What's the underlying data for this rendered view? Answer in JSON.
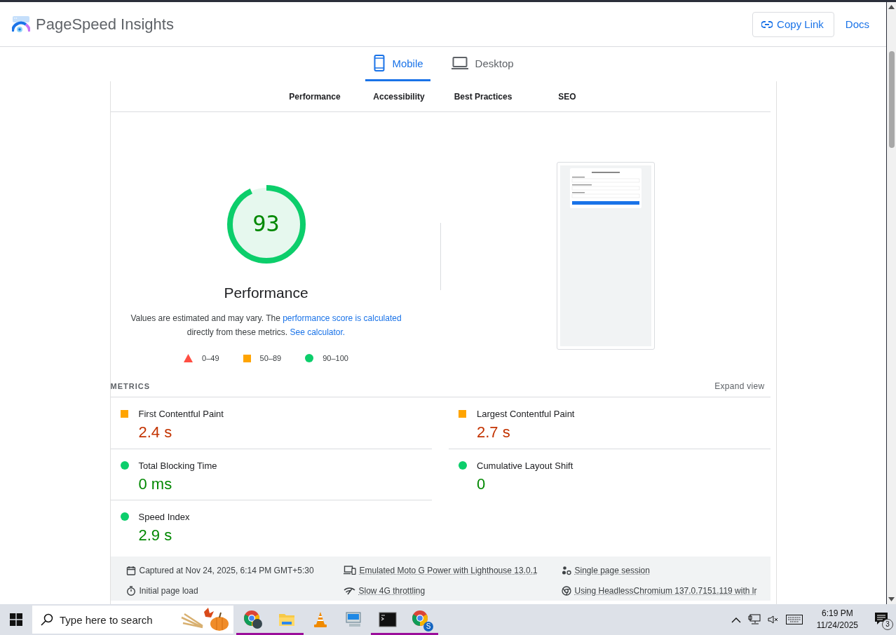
{
  "header": {
    "title": "PageSpeed Insights",
    "copy_link": "Copy Link",
    "docs": "Docs"
  },
  "device_tabs": [
    {
      "label": "Mobile",
      "kind": "mobile",
      "selected": true
    },
    {
      "label": "Desktop",
      "kind": "desktop",
      "selected": false
    }
  ],
  "category_tabs": [
    "Performance",
    "Accessibility",
    "Best Practices",
    "SEO"
  ],
  "score": {
    "value": "93",
    "level": 0.93,
    "kind": "pass",
    "label": "Performance"
  },
  "note": [
    {
      "kind": "text",
      "text": "Values are estimated and may vary. The "
    },
    {
      "kind": "link",
      "text": "performance score is calculated"
    },
    {
      "kind": "text",
      "text": " directly from these metrics. "
    },
    {
      "kind": "link",
      "text": "See calculator."
    }
  ],
  "legend": [
    {
      "kind": "fail",
      "range": "0–49"
    },
    {
      "kind": "average",
      "range": "50–89"
    },
    {
      "kind": "pass",
      "range": "90–100"
    }
  ],
  "metrics": {
    "title": "METRICS",
    "expand": "Expand view",
    "items": [
      {
        "name": "First Contentful Paint",
        "value": "2.4 s",
        "kind": "average"
      },
      {
        "name": "Largest Contentful Paint",
        "value": "2.7 s",
        "kind": "average"
      },
      {
        "name": "Total Blocking Time",
        "value": "0 ms",
        "kind": "pass"
      },
      {
        "name": "Cumulative Layout Shift",
        "value": "0",
        "kind": "pass"
      },
      {
        "name": "Speed Index",
        "value": "2.9 s",
        "kind": "pass"
      }
    ]
  },
  "run_info": [
    {
      "kind": "calendar",
      "text": "Captured at Nov 24, 2025, 6:14 PM GMT+5:30",
      "underlined": false
    },
    {
      "kind": "devices",
      "text": "Emulated Moto G Power with Lighthouse 13.0.1",
      "underlined": true
    },
    {
      "kind": "people",
      "text": "Single page session",
      "underlined": true
    },
    {
      "kind": "stopwatch",
      "text": "Initial page load",
      "underlined": false
    },
    {
      "kind": "signal",
      "text": "Slow 4G throttling",
      "underlined": true
    },
    {
      "kind": "chrome",
      "text": "Using HeadlessChromium 137.0.7151.119 with lr",
      "underlined": true
    }
  ],
  "taskbar": {
    "search": {
      "placeholder": "Type here to search"
    },
    "apps": [
      {
        "kind": "chrome-profile",
        "running": true
      },
      {
        "kind": "folder",
        "running": true
      },
      {
        "kind": "cone",
        "running": false
      },
      {
        "kind": "computer",
        "running": false
      },
      {
        "kind": "terminal",
        "running": true
      },
      {
        "kind": "chrome-letter",
        "badge": "S",
        "running": true
      }
    ],
    "time": "6:19 PM",
    "date": "11/24/2025",
    "notifications": "3"
  }
}
